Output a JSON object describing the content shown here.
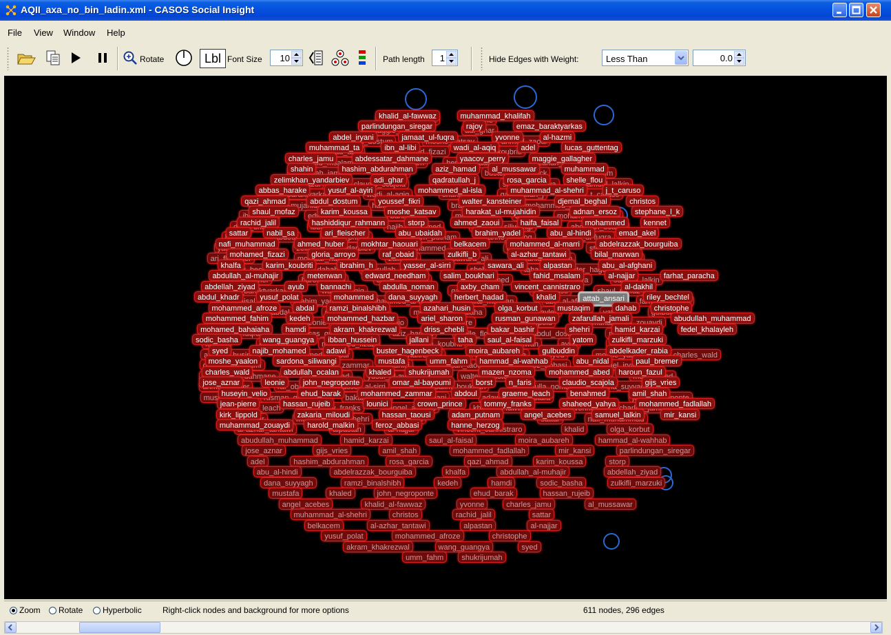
{
  "window": {
    "title": "AQII_axa_no_bin_ladin.xml - CASOS Social Insight"
  },
  "menu": [
    "File",
    "View",
    "Window",
    "Help"
  ],
  "toolbar": {
    "rotate_label": "Rotate",
    "lbl_button": "Lbl",
    "font_size_label": "Font Size",
    "font_size_value": "10",
    "path_length_label": "Path length",
    "path_length_value": "1",
    "hide_edges_label": "Hide Edges with Weight:",
    "hide_edges_operator": "Less Than",
    "hide_edges_value": "0.0"
  },
  "graph": {
    "selected_node": "attab_ansari",
    "nodes": [
      "khalid_al-fawwaz",
      "muhammad_khalifah",
      "parlindungan_siregar",
      "rajoy",
      "emaz_baraktyarkas",
      "abdel_iryani",
      "jamaat_ul-fuqra",
      "yvonne",
      "al-hazmi",
      "muhammad_ta",
      "ibn_al-libi",
      "wadi_al-aqiq",
      "adel",
      "lucas_guttentag",
      "charles_jamu",
      "abdessatar_dahmane",
      "yaacov_perry",
      "maggie_gallagher",
      "shahin",
      "hashim_abdurahman",
      "aziz_hamad",
      "al_mussawar",
      "muhammad",
      "zelimkhan_yandarbiev",
      "adi_ghar",
      "qadratullah_j",
      "rosa_garcia",
      "shelle_flou",
      "abbas_harake",
      "yusuf_al-ayiri",
      "mohammed_al-isla",
      "muhammad_al-shehri",
      "j_t_caruso",
      "qazi_ahmad",
      "abdul_dostum",
      "youssef_fikri",
      "walter_kansteiner",
      "djemal_beghal",
      "christos",
      "shaul_mofaz",
      "karim_koussa",
      "moshe_katsav",
      "harakat_ul-mujahidin",
      "adnan_ersoz",
      "stephane_l_k",
      "rachid_jalil",
      "hashiddiqur_rahmann",
      "storp",
      "ahmed_zaoui",
      "haifa_faisal",
      "mohammed",
      "kennet",
      "sattar",
      "nabil_sa",
      "ari_fleischer",
      "abu_ubaidah",
      "brahim_yadel",
      "abu_al-hindi",
      "emad_akel",
      "nafi_muhammad",
      "ahmed_huber",
      "mokhtar_haouari",
      "belkacem",
      "mohammed_al-marri",
      "abdelrazzak_bourguiba",
      "mohamed_fizazi",
      "gloria_arroyo",
      "raf_obaid",
      "zulkifli_b",
      "al-azhar_tantawi",
      "bilal_marwan",
      "khalfa",
      "karim_koubriti",
      "ibrahim_h",
      "yasser_al-sirri",
      "sawara_ali",
      "alpastan",
      "abu_al-afghani",
      "abdullah_al-muhajir",
      "metenwan",
      "edward_needham",
      "salim_boukhari",
      "fahid_msalam",
      "al-najjar",
      "farhat_paracha",
      "abdellah_ziyad",
      "ayub",
      "bannachi",
      "abdulla_noman",
      "axby_cham",
      "vincent_cannistraro",
      "al-dakhil",
      "abdul_khadr",
      "yusuf_polat",
      "mohammed",
      "dana_suyyagh",
      "herbert_hadad",
      "khalid",
      "attab_ansari",
      "riley_bechtel",
      "mohammed_afroze",
      "abdal",
      "ramzi_binalshibh",
      "azahari_husin",
      "olga_korbut",
      "mustaqim",
      "dahab",
      "christophe",
      "mohammed_fahim",
      "kedeh",
      "mohammed_hazbar",
      "ariel_sharon",
      "rusman_gunawan",
      "zafarullah_jamali",
      "abudullah_muhammad",
      "mohamed_bahaiaha",
      "hamdi",
      "akram_khakrezwal",
      "driss_chebli",
      "bakar_bashir",
      "shehri",
      "hamid_karzai",
      "fedel_khalayleh",
      "sodic_basha",
      "wang_guangya",
      "ibban_hussein",
      "jallani",
      "taha",
      "saul_al-faisal",
      "yatom",
      "zulkifli_marzuki",
      "syed",
      "najib_mohamed",
      "adawi",
      "buster_hagenbeck",
      "moira_aubareh",
      "gulbuddin",
      "abdelkader_rabia",
      "moshe_yaalon",
      "sardona_siliwangi",
      "mustafa",
      "umm_fahm",
      "hammad_al-wahhab",
      "abu_nidal",
      "paul_bremer",
      "charles_wald",
      "abdullah_ocalan",
      "khaled",
      "shukrijumah",
      "mazen_nzoma",
      "mohammed_abed",
      "haroun_fazul",
      "jose_aznar",
      "leonie",
      "john_negroponte",
      "omar_al-bayoumi",
      "borst",
      "n_faris",
      "claudio_scajola",
      "gijs_vries",
      "huseyin_velio",
      "ehud_barak",
      "mohammed_zammar",
      "abdoul",
      "graeme_leach",
      "benahmed",
      "amil_shah",
      "jean-pierre",
      "hassan_rujeib",
      "lounici",
      "crown_prince",
      "tommy_franks",
      "shaheed_yahya",
      "mohammed_fadlallah",
      "kirk_lippold",
      "zakaria_miloudi",
      "hassan_taousi",
      "adam_putnam",
      "angel_acebes",
      "samuel_lalkin",
      "mir_kansi",
      "muhammad_zouaydi",
      "harold_malkin",
      "feroz_abbasi",
      "hanne_herzog"
    ]
  },
  "status": {
    "modes": [
      "Zoom",
      "Rotate",
      "Hyperbolic"
    ],
    "selected_mode": "Zoom",
    "hint": "Right-click nodes and background for more options",
    "counts": "611 nodes, 296 edges"
  }
}
